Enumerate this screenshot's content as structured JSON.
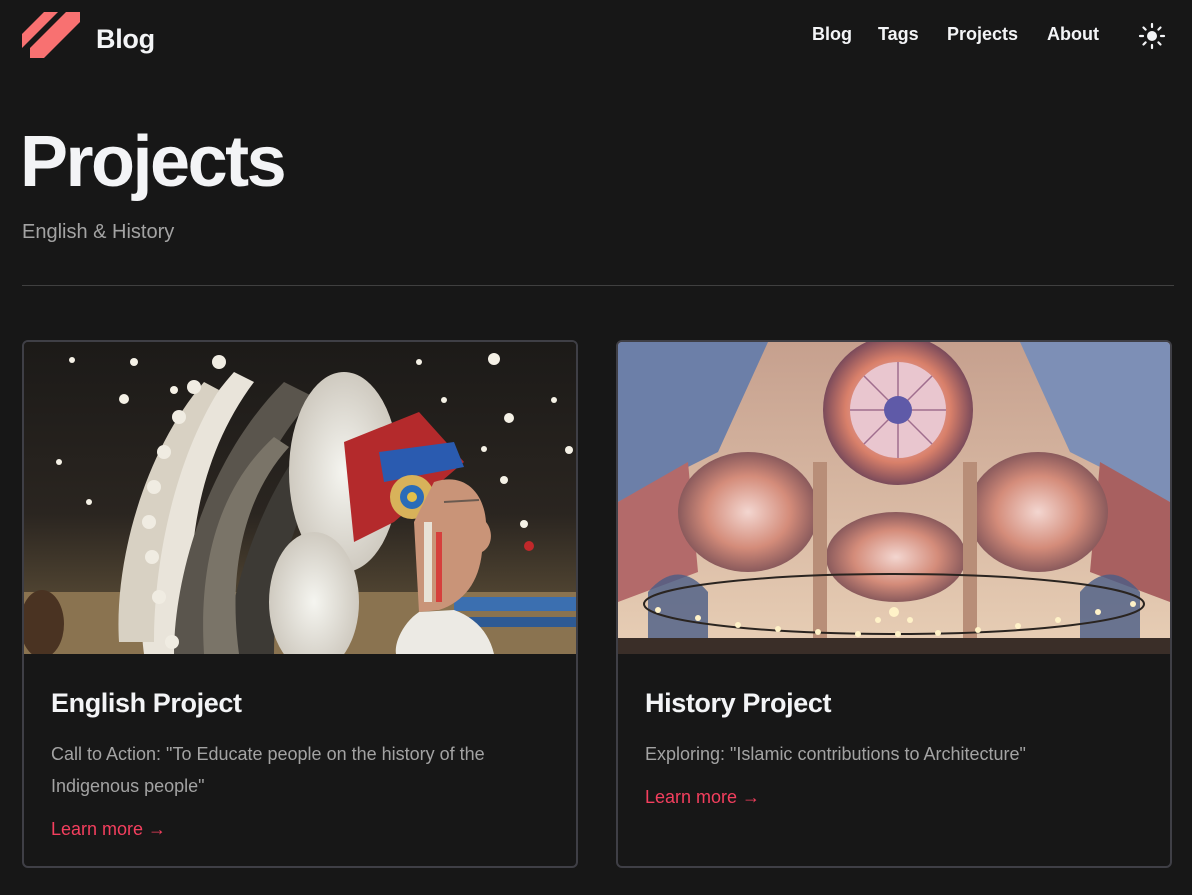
{
  "header": {
    "brand": "Blog",
    "nav": [
      {
        "label": "Blog"
      },
      {
        "label": "Tags"
      },
      {
        "label": "Projects"
      },
      {
        "label": "About"
      }
    ],
    "theme_toggle_icon": "sun-icon"
  },
  "page": {
    "title": "Projects",
    "subtitle": "English & History"
  },
  "projects": [
    {
      "title": "English Project",
      "description": "Call to Action: \"To Educate people on the history of the Indigenous people\"",
      "link": "Learn more →",
      "image": "indigenous-headdress-photo"
    },
    {
      "title": "History Project",
      "description": "Exploring: \"Islamic contributions to Architecture\"",
      "link": "Learn more →",
      "image": "mosque-dome-interior-photo"
    }
  ],
  "colors": {
    "background": "#171717",
    "accent": "#f43f5e",
    "logo": "#f87171",
    "text": "#f3f4f6",
    "muted": "#a3a3a3"
  }
}
